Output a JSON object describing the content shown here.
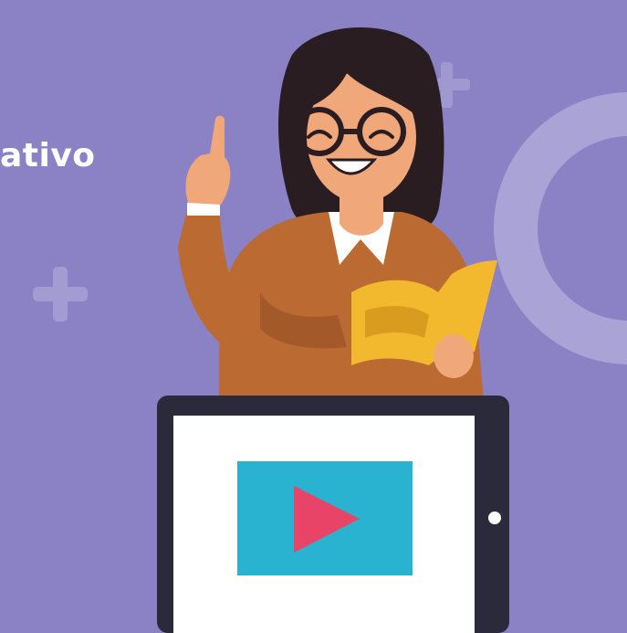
{
  "headline": {
    "text": "ativo"
  },
  "palette": {
    "background": "#8a82c4",
    "ring": "#a9a3d6",
    "plus": "#a39cd3",
    "hair": "#2a1d22",
    "skin": "#f0a77a",
    "jacket": "#bb6a31",
    "jacket_shadow": "#a3592a",
    "shirt": "#ffffff",
    "book": "#f2b92e",
    "book_shade": "#d99c1f",
    "tablet_frame": "#2b2a3b",
    "tablet_screen": "#ffffff",
    "video_bg": "#2ab3d1",
    "play": "#e84468"
  },
  "icons": [
    "plus-icon",
    "ring-decoration",
    "play-icon",
    "tablet-home-button"
  ]
}
